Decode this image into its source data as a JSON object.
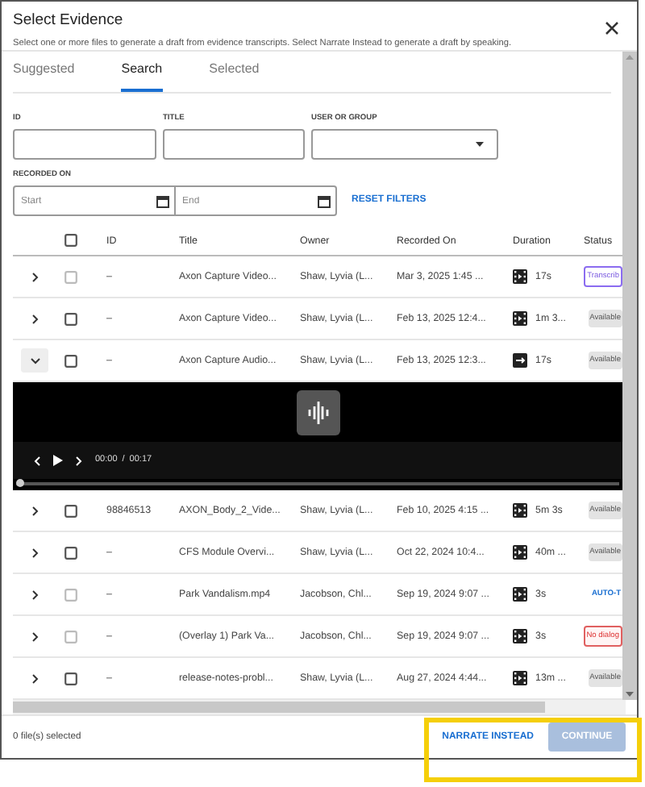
{
  "dialog": {
    "title": "Select Evidence",
    "subtitle": "Select one or more files to generate a draft from evidence transcripts. Select Narrate Instead to generate a draft by speaking."
  },
  "tabs": [
    {
      "label": "Suggested",
      "selected": false
    },
    {
      "label": "Search",
      "selected": true
    },
    {
      "label": "Selected",
      "selected": false
    }
  ],
  "filters": {
    "id_label": "ID",
    "title_label": "TITLE",
    "user_label": "USER OR GROUP",
    "recorded_label": "RECORDED ON",
    "start_placeholder": "Start",
    "end_placeholder": "End",
    "reset": "RESET FILTERS"
  },
  "table": {
    "columns": [
      "ID",
      "Title",
      "Owner",
      "Recorded On",
      "Duration",
      "Status"
    ],
    "select_all_checked": false,
    "rows": [
      {
        "id": "–",
        "title": "Axon Capture Video...",
        "owner": "Shaw, Lyvia (L...",
        "recorded": "Mar 3, 2025 1:45 ...",
        "duration": {
          "kind": "video",
          "text": "17s"
        },
        "status": {
          "kind": "processing",
          "text": "Transcrib"
        },
        "expanded": false,
        "checked": false,
        "disabled": true
      },
      {
        "id": "–",
        "title": "Axon Capture Video...",
        "owner": "Shaw, Lyvia (L...",
        "recorded": "Feb 13, 2025 12:4...",
        "duration": {
          "kind": "video",
          "text": "1m 3..."
        },
        "status": {
          "kind": "available",
          "text": "Available"
        },
        "expanded": false,
        "checked": false,
        "disabled": false
      },
      {
        "id": "–",
        "title": "Axon Capture Audio...",
        "owner": "Shaw, Lyvia (L...",
        "recorded": "Feb 13, 2025 12:3...",
        "duration": {
          "kind": "audio",
          "text": "17s"
        },
        "status": {
          "kind": "available",
          "text": "Available"
        },
        "expanded": true,
        "checked": false,
        "disabled": false,
        "player": {
          "current": "00:00",
          "separator": "/",
          "total": "00:17",
          "level": 0
        }
      },
      {
        "id": "98846513",
        "title": "AXON_Body_2_Vide...",
        "owner": "Shaw, Lyvia (L...",
        "recorded": "Feb 10, 2025 4:15 ...",
        "duration": {
          "kind": "video",
          "text": "5m 3s"
        },
        "status": {
          "kind": "available",
          "text": "Available"
        },
        "expanded": false,
        "checked": false,
        "disabled": false
      },
      {
        "id": "–",
        "title": "CFS Module Overvi...",
        "owner": "Shaw, Lyvia (L...",
        "recorded": "Oct 22, 2024 10:4...",
        "duration": {
          "kind": "video",
          "text": "40m ..."
        },
        "status": {
          "kind": "available",
          "text": "Available"
        },
        "expanded": false,
        "checked": false,
        "disabled": false
      },
      {
        "id": "–",
        "title": "Park Vandalism.mp4",
        "owner": "Jacobson, Chl...",
        "recorded": "Sep 19, 2024 9:07 ...",
        "duration": {
          "kind": "video",
          "text": "3s"
        },
        "status": {
          "kind": "action",
          "text": "AUTO-T"
        },
        "expanded": false,
        "checked": false,
        "disabled": true
      },
      {
        "id": "–",
        "title": "(Overlay 1) Park Va...",
        "owner": "Jacobson, Chl...",
        "recorded": "Sep 19, 2024 9:07 ...",
        "duration": {
          "kind": "video",
          "text": "3s"
        },
        "status": {
          "kind": "error",
          "text": "No dialog"
        },
        "expanded": false,
        "checked": false,
        "disabled": true
      },
      {
        "id": "–",
        "title": "release-notes-probl...",
        "owner": "Shaw, Lyvia (L...",
        "recorded": "Aug 27, 2024 4:44...",
        "duration": {
          "kind": "video",
          "text": "13m ..."
        },
        "status": {
          "kind": "available",
          "text": "Available"
        },
        "expanded": false,
        "checked": false,
        "disabled": false
      }
    ]
  },
  "footer": {
    "count": "0 file(s) selected",
    "narrate": "NARRATE INSTEAD",
    "continue": "CONTINUE",
    "continue_disabled": true,
    "highlighted": true
  }
}
